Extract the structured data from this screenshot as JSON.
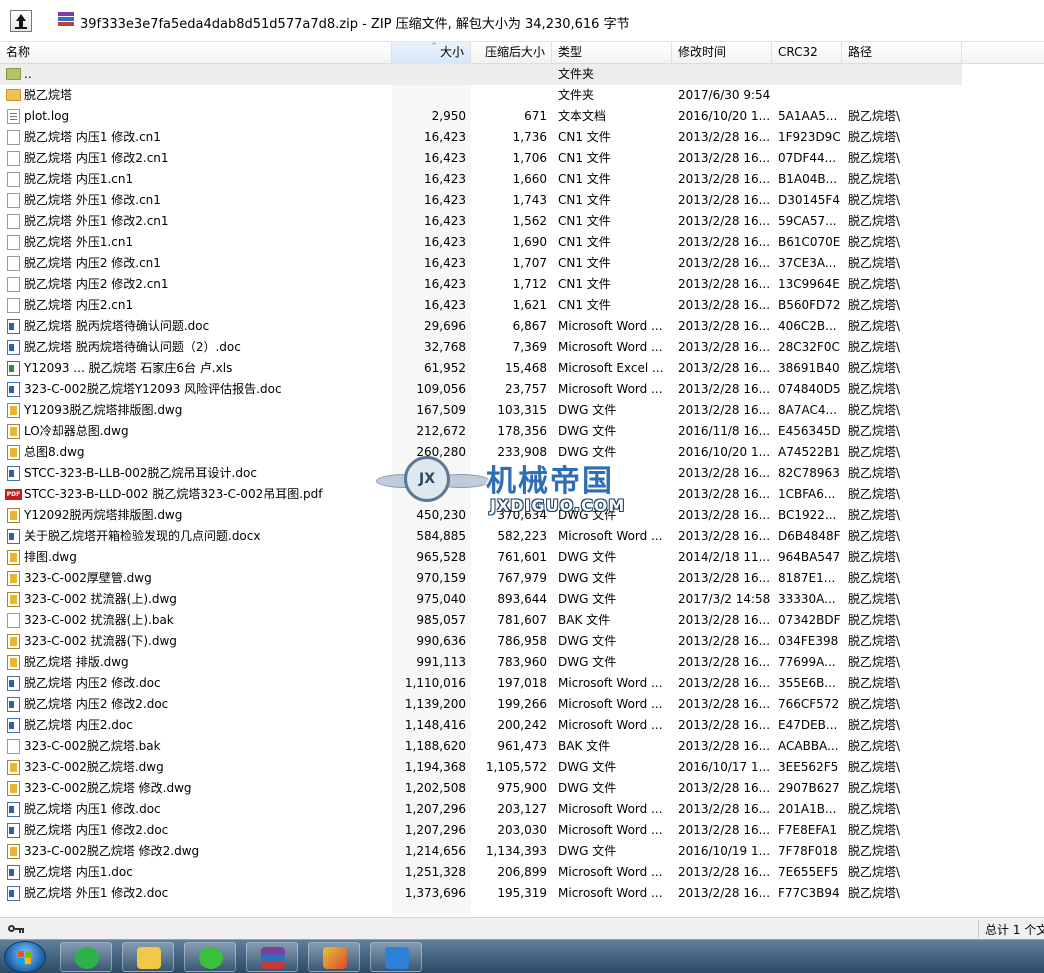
{
  "archive_title": "39f333e3e7fa5eda4dab8d51d577a7d8.zip - ZIP 压缩文件, 解包大小为 34,230,616 字节",
  "columns": {
    "name": "名称",
    "size": "大小",
    "packed": "压缩后大小",
    "type": "类型",
    "modified": "修改时间",
    "crc": "CRC32",
    "path": "路径"
  },
  "files": [
    {
      "icon": "folder-up-icon",
      "name": "..",
      "size": "",
      "packed": "",
      "type": "文件夹",
      "modified": "",
      "crc": "",
      "path": ""
    },
    {
      "icon": "folder-icon",
      "name": "脱乙烷塔",
      "size": "",
      "packed": "",
      "type": "文件夹",
      "modified": "2017/6/30 9:54",
      "crc": "",
      "path": ""
    },
    {
      "icon": "log-file-icon",
      "name": "plot.log",
      "size": "2,950",
      "packed": "671",
      "type": "文本文档",
      "modified": "2016/10/20 1...",
      "crc": "5A1AA5...",
      "path": "脱乙烷塔\\"
    },
    {
      "icon": "file-icon",
      "name": "脱乙烷塔  内压1 修改.cn1",
      "size": "16,423",
      "packed": "1,736",
      "type": "CN1 文件",
      "modified": "2013/2/28 16...",
      "crc": "1F923D9C",
      "path": "脱乙烷塔\\"
    },
    {
      "icon": "file-icon",
      "name": "脱乙烷塔  内压1 修改2.cn1",
      "size": "16,423",
      "packed": "1,706",
      "type": "CN1 文件",
      "modified": "2013/2/28 16...",
      "crc": "07DF44...",
      "path": "脱乙烷塔\\"
    },
    {
      "icon": "file-icon",
      "name": "脱乙烷塔  内压1.cn1",
      "size": "16,423",
      "packed": "1,660",
      "type": "CN1 文件",
      "modified": "2013/2/28 16...",
      "crc": "B1A04B...",
      "path": "脱乙烷塔\\"
    },
    {
      "icon": "file-icon",
      "name": "脱乙烷塔  外压1 修改.cn1",
      "size": "16,423",
      "packed": "1,743",
      "type": "CN1 文件",
      "modified": "2013/2/28 16...",
      "crc": "D30145F4",
      "path": "脱乙烷塔\\"
    },
    {
      "icon": "file-icon",
      "name": "脱乙烷塔  外压1 修改2.cn1",
      "size": "16,423",
      "packed": "1,562",
      "type": "CN1 文件",
      "modified": "2013/2/28 16...",
      "crc": "59CA57...",
      "path": "脱乙烷塔\\"
    },
    {
      "icon": "file-icon",
      "name": "脱乙烷塔  外压1.cn1",
      "size": "16,423",
      "packed": "1,690",
      "type": "CN1 文件",
      "modified": "2013/2/28 16...",
      "crc": "B61C070E",
      "path": "脱乙烷塔\\"
    },
    {
      "icon": "file-icon",
      "name": "脱乙烷塔 内压2 修改.cn1",
      "size": "16,423",
      "packed": "1,707",
      "type": "CN1 文件",
      "modified": "2013/2/28 16...",
      "crc": "37CE3A...",
      "path": "脱乙烷塔\\"
    },
    {
      "icon": "file-icon",
      "name": "脱乙烷塔 内压2 修改2.cn1",
      "size": "16,423",
      "packed": "1,712",
      "type": "CN1 文件",
      "modified": "2013/2/28 16...",
      "crc": "13C9964E",
      "path": "脱乙烷塔\\"
    },
    {
      "icon": "file-icon",
      "name": "脱乙烷塔 内压2.cn1",
      "size": "16,423",
      "packed": "1,621",
      "type": "CN1 文件",
      "modified": "2013/2/28 16...",
      "crc": "B560FD72",
      "path": "脱乙烷塔\\"
    },
    {
      "icon": "word-doc-icon",
      "name": "脱乙烷塔 脱丙烷塔待确认问题.doc",
      "size": "29,696",
      "packed": "6,867",
      "type": "Microsoft Word ...",
      "modified": "2013/2/28 16...",
      "crc": "406C2B...",
      "path": "脱乙烷塔\\"
    },
    {
      "icon": "word-doc-icon",
      "name": "脱乙烷塔 脱丙烷塔待确认问题（2）.doc",
      "size": "32,768",
      "packed": "7,369",
      "type": "Microsoft Word ...",
      "modified": "2013/2/28 16...",
      "crc": "28C32F0C",
      "path": "脱乙烷塔\\"
    },
    {
      "icon": "excel-xls-icon",
      "name": "Y12093 ... 脱乙烷塔    石家庄6台   卢.xls",
      "size": "61,952",
      "packed": "15,468",
      "type": "Microsoft Excel ...",
      "modified": "2013/2/28 16...",
      "crc": "38691B40",
      "path": "脱乙烷塔\\"
    },
    {
      "icon": "word-doc-icon",
      "name": "323-C-002脱乙烷塔Y12093  风险评估报告.doc",
      "size": "109,056",
      "packed": "23,757",
      "type": "Microsoft Word ...",
      "modified": "2013/2/28 16...",
      "crc": "074840D5",
      "path": "脱乙烷塔\\"
    },
    {
      "icon": "dwg-file-icon",
      "name": "Y12093脱乙烷塔排版图.dwg",
      "size": "167,509",
      "packed": "103,315",
      "type": "DWG 文件",
      "modified": "2013/2/28 16...",
      "crc": "8A7AC4...",
      "path": "脱乙烷塔\\"
    },
    {
      "icon": "dwg-file-icon",
      "name": "LO冷却器总图.dwg",
      "size": "212,672",
      "packed": "178,356",
      "type": "DWG 文件",
      "modified": "2016/11/8 16...",
      "crc": "E456345D",
      "path": "脱乙烷塔\\"
    },
    {
      "icon": "dwg-file-icon",
      "name": "总图8.dwg",
      "size": "260,280",
      "packed": "233,908",
      "type": "DWG 文件",
      "modified": "2016/10/20 1...",
      "crc": "A74522B1",
      "path": "脱乙烷塔\\"
    },
    {
      "icon": "word-doc-icon",
      "name": "STCC-323-B-LLB-002脱乙烷吊耳设计.doc",
      "size": "",
      "packed": "",
      "type": "",
      "modified": "2013/2/28 16...",
      "crc": "82C78963",
      "path": "脱乙烷塔\\"
    },
    {
      "icon": "pdf-file-icon",
      "name": "STCC-323-B-LLD-002 脱乙烷塔323-C-002吊耳图.pdf",
      "size": "",
      "packed": "",
      "type": "",
      "modified": "2013/2/28 16...",
      "crc": "1CBFA6...",
      "path": "脱乙烷塔\\"
    },
    {
      "icon": "dwg-file-icon",
      "name": "Y12092脱丙烷塔排版图.dwg",
      "size": "450,230",
      "packed": "370,634",
      "type": "DWG 文件",
      "modified": "2013/2/28 16...",
      "crc": "BC1922...",
      "path": "脱乙烷塔\\"
    },
    {
      "icon": "word-doc-icon",
      "name": "关于脱乙烷塔开箱检验发现的几点问题.docx",
      "size": "584,885",
      "packed": "582,223",
      "type": "Microsoft Word ...",
      "modified": "2013/2/28 16...",
      "crc": "D6B4848F",
      "path": "脱乙烷塔\\"
    },
    {
      "icon": "dwg-file-icon",
      "name": "排图.dwg",
      "size": "965,528",
      "packed": "761,601",
      "type": "DWG 文件",
      "modified": "2014/2/18 11...",
      "crc": "964BA547",
      "path": "脱乙烷塔\\"
    },
    {
      "icon": "dwg-file-icon",
      "name": "323-C-002厚壁管.dwg",
      "size": "970,159",
      "packed": "767,979",
      "type": "DWG 文件",
      "modified": "2013/2/28 16...",
      "crc": "8187E1...",
      "path": "脱乙烷塔\\"
    },
    {
      "icon": "dwg-file-icon",
      "name": "323-C-002 扰流器(上).dwg",
      "size": "975,040",
      "packed": "893,644",
      "type": "DWG 文件",
      "modified": "2017/3/2 14:58",
      "crc": "33330A...",
      "path": "脱乙烷塔\\"
    },
    {
      "icon": "file-icon",
      "name": "323-C-002 扰流器(上).bak",
      "size": "985,057",
      "packed": "781,607",
      "type": "BAK 文件",
      "modified": "2013/2/28 16...",
      "crc": "07342BDF",
      "path": "脱乙烷塔\\"
    },
    {
      "icon": "dwg-file-icon",
      "name": "323-C-002 扰流器(下).dwg",
      "size": "990,636",
      "packed": "786,958",
      "type": "DWG 文件",
      "modified": "2013/2/28 16...",
      "crc": "034FE398",
      "path": "脱乙烷塔\\"
    },
    {
      "icon": "dwg-file-icon",
      "name": "脱乙烷塔 排版.dwg",
      "size": "991,113",
      "packed": "783,960",
      "type": "DWG 文件",
      "modified": "2013/2/28 16...",
      "crc": "77699A...",
      "path": "脱乙烷塔\\"
    },
    {
      "icon": "word-doc-icon",
      "name": "脱乙烷塔 内压2 修改.doc",
      "size": "1,110,016",
      "packed": "197,018",
      "type": "Microsoft Word ...",
      "modified": "2013/2/28 16...",
      "crc": "355E6B...",
      "path": "脱乙烷塔\\"
    },
    {
      "icon": "word-doc-icon",
      "name": "脱乙烷塔 内压2 修改2.doc",
      "size": "1,139,200",
      "packed": "199,266",
      "type": "Microsoft Word ...",
      "modified": "2013/2/28 16...",
      "crc": "766CF572",
      "path": "脱乙烷塔\\"
    },
    {
      "icon": "word-doc-icon",
      "name": "脱乙烷塔 内压2.doc",
      "size": "1,148,416",
      "packed": "200,242",
      "type": "Microsoft Word ...",
      "modified": "2013/2/28 16...",
      "crc": "E47DEB...",
      "path": "脱乙烷塔\\"
    },
    {
      "icon": "file-icon",
      "name": "323-C-002脱乙烷塔.bak",
      "size": "1,188,620",
      "packed": "961,473",
      "type": "BAK 文件",
      "modified": "2013/2/28 16...",
      "crc": "ACABBA...",
      "path": "脱乙烷塔\\"
    },
    {
      "icon": "dwg-file-icon",
      "name": "323-C-002脱乙烷塔.dwg",
      "size": "1,194,368",
      "packed": "1,105,572",
      "type": "DWG 文件",
      "modified": "2016/10/17 1...",
      "crc": "3EE562F5",
      "path": "脱乙烷塔\\"
    },
    {
      "icon": "dwg-file-icon",
      "name": "323-C-002脱乙烷塔 修改.dwg",
      "size": "1,202,508",
      "packed": "975,900",
      "type": "DWG 文件",
      "modified": "2013/2/28 16...",
      "crc": "2907B627",
      "path": "脱乙烷塔\\"
    },
    {
      "icon": "word-doc-icon",
      "name": "脱乙烷塔 内压1 修改.doc",
      "size": "1,207,296",
      "packed": "203,127",
      "type": "Microsoft Word ...",
      "modified": "2013/2/28 16...",
      "crc": "201A1B...",
      "path": "脱乙烷塔\\"
    },
    {
      "icon": "word-doc-icon",
      "name": "脱乙烷塔 内压1 修改2.doc",
      "size": "1,207,296",
      "packed": "203,030",
      "type": "Microsoft Word ...",
      "modified": "2013/2/28 16...",
      "crc": "F7E8EFA1",
      "path": "脱乙烷塔\\"
    },
    {
      "icon": "dwg-file-icon",
      "name": "323-C-002脱乙烷塔 修改2.dwg",
      "size": "1,214,656",
      "packed": "1,134,393",
      "type": "DWG 文件",
      "modified": "2016/10/19 1...",
      "crc": "7F78F018",
      "path": "脱乙烷塔\\"
    },
    {
      "icon": "word-doc-icon",
      "name": "脱乙烷塔 内压1.doc",
      "size": "1,251,328",
      "packed": "206,899",
      "type": "Microsoft Word ...",
      "modified": "2013/2/28 16...",
      "crc": "7E655EF5",
      "path": "脱乙烷塔\\"
    },
    {
      "icon": "word-doc-icon",
      "name": "脱乙烷塔 外压1 修改2.doc",
      "size": "1,373,696",
      "packed": "195,319",
      "type": "Microsoft Word ...",
      "modified": "2013/2/28 16...",
      "crc": "F77C3B94",
      "path": "脱乙烷塔\\"
    }
  ],
  "watermark": {
    "badge": "JX",
    "title": "机械帝国",
    "url": "JXDIGUO.COM"
  },
  "status_text": "总计 1 个文",
  "colors": {
    "selected_row": "#ededed",
    "sorted_header": "#d5e7f8",
    "taskbar": "#2c4a66"
  },
  "taskbar": {
    "start_icon": "windows-start-icon",
    "apps": [
      "refresh-app-icon",
      "notepad-app-icon",
      "wechat-app-icon",
      "winrar-app-icon",
      "pencil-app-icon",
      "wps-writer-app-icon"
    ]
  }
}
